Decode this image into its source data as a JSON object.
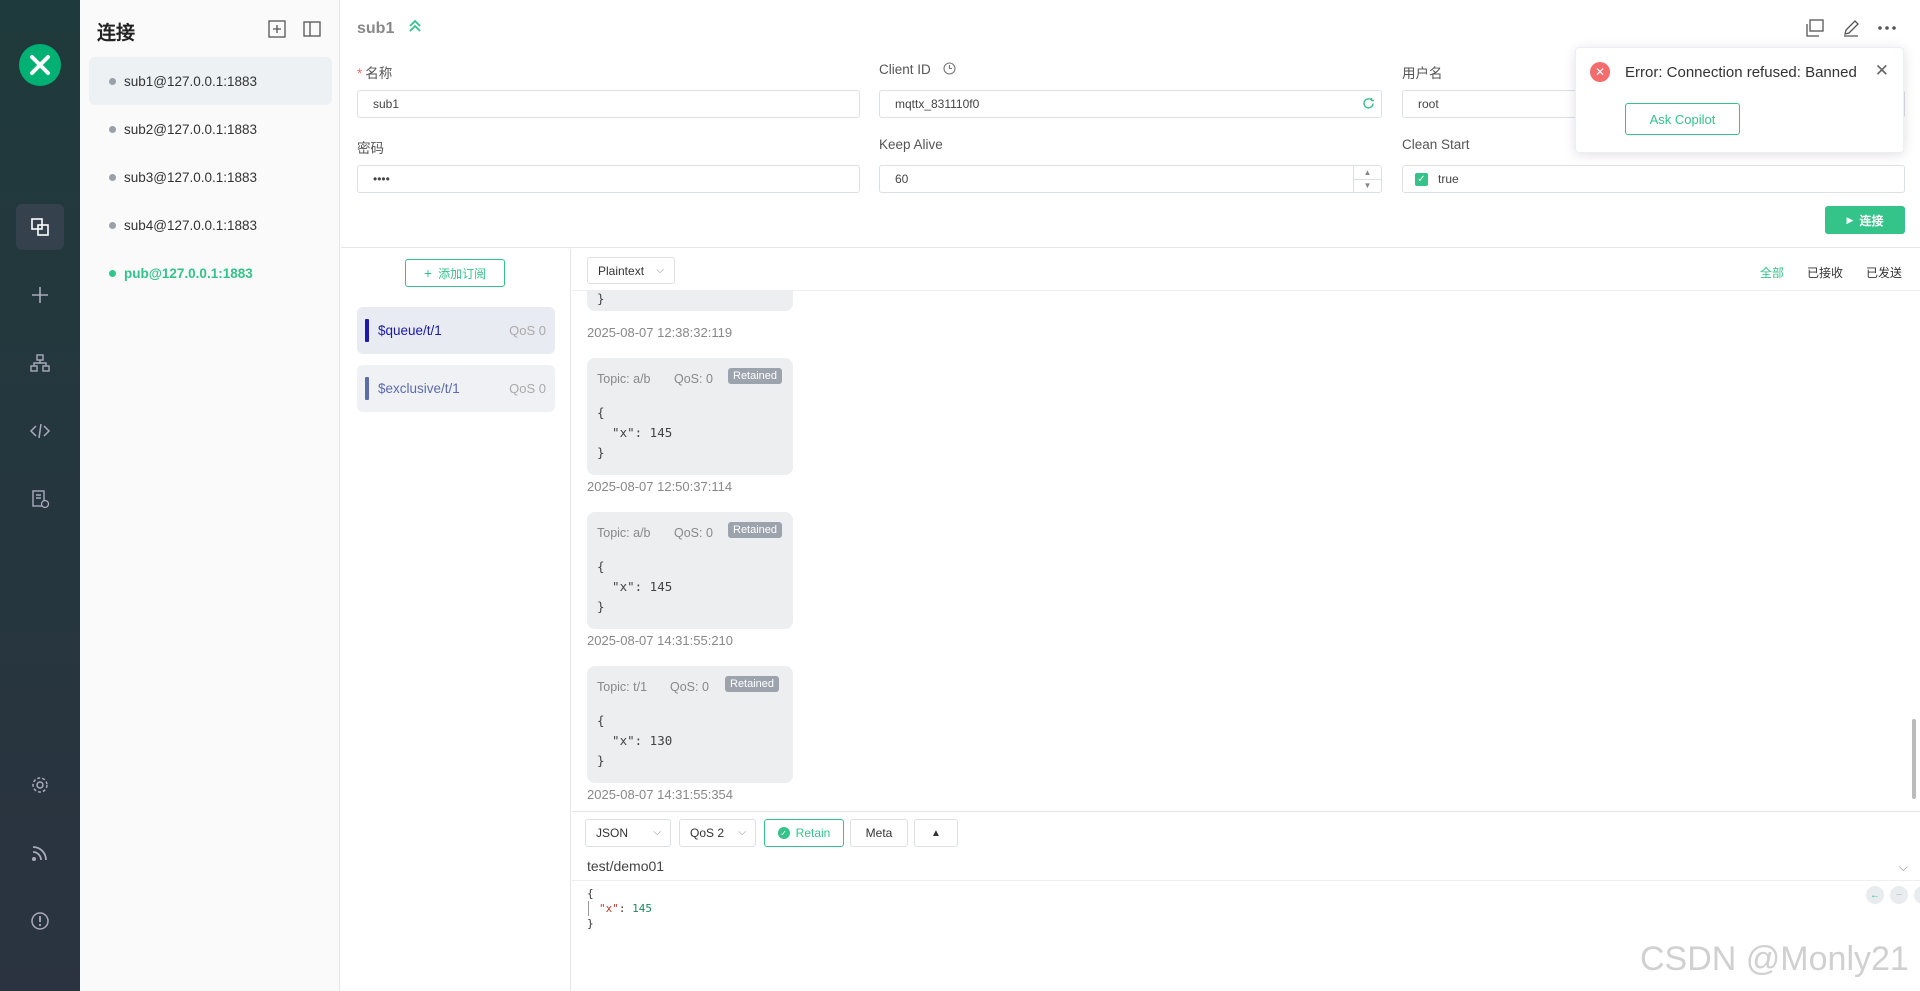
{
  "sidebar": {
    "title": "连接"
  },
  "connections": [
    {
      "label": "sub1@127.0.0.1:1883"
    },
    {
      "label": "sub2@127.0.0.1:1883"
    },
    {
      "label": "sub3@127.0.0.1:1883"
    },
    {
      "label": "sub4@127.0.0.1:1883"
    },
    {
      "label": "pub@127.0.0.1:1883"
    }
  ],
  "header": {
    "title": "sub1"
  },
  "form": {
    "name_label": "名称",
    "name_value": "sub1",
    "client_id_label": "Client ID",
    "client_id_value": "mqttx_831110f0",
    "username_label": "用户名",
    "username_value": "root",
    "password_label": "密码",
    "password_value": "••••",
    "keep_alive_label": "Keep Alive",
    "keep_alive_value": "60",
    "clean_start_label": "Clean Start",
    "clean_start_value": "true",
    "connect_label": "连接"
  },
  "toast": {
    "message": "Error: Connection refused: Banned",
    "button": "Ask Copilot"
  },
  "subscriptions": {
    "add_label": "添加订阅",
    "items": [
      {
        "topic": "$queue/t/1",
        "qos": "QoS 0",
        "color": "#1a1aa6"
      },
      {
        "topic": "$exclusive/t/1",
        "qos": "QoS 0",
        "color": "#5b6bb0"
      }
    ]
  },
  "messages": {
    "format": "Plaintext",
    "filters": [
      "全部",
      "已接收",
      "已发送"
    ],
    "first_ts": "2025-08-07 12:38:32:119",
    "partial_brace": "}",
    "items": [
      {
        "topic": "Topic: a/b",
        "qos": "QoS: 0",
        "retained": "Retained",
        "payload": "{\n  \"x\": 145\n}",
        "ts": "2025-08-07 12:50:37:114"
      },
      {
        "topic": "Topic: a/b",
        "qos": "QoS: 0",
        "retained": "Retained",
        "payload": "{\n  \"x\": 145\n}",
        "ts": "2025-08-07 14:31:55:210"
      },
      {
        "topic": "Topic: t/1",
        "qos": "QoS: 0",
        "retained": "Retained",
        "payload": "{\n  \"x\": 130\n}",
        "ts": "2025-08-07 14:31:55:354"
      }
    ]
  },
  "publish": {
    "format": "JSON",
    "qos": "QoS 2",
    "retain": "Retain",
    "meta": "Meta",
    "topic": "test/demo01",
    "payload_open": "{",
    "payload_key": "\"x\"",
    "payload_sep": ": ",
    "payload_val": "145",
    "payload_close": "}"
  },
  "watermark": "CSDN @Monly21",
  "colors": {
    "accent": "#34c388",
    "error": "#f56c6c",
    "rail": "#2b3340"
  }
}
